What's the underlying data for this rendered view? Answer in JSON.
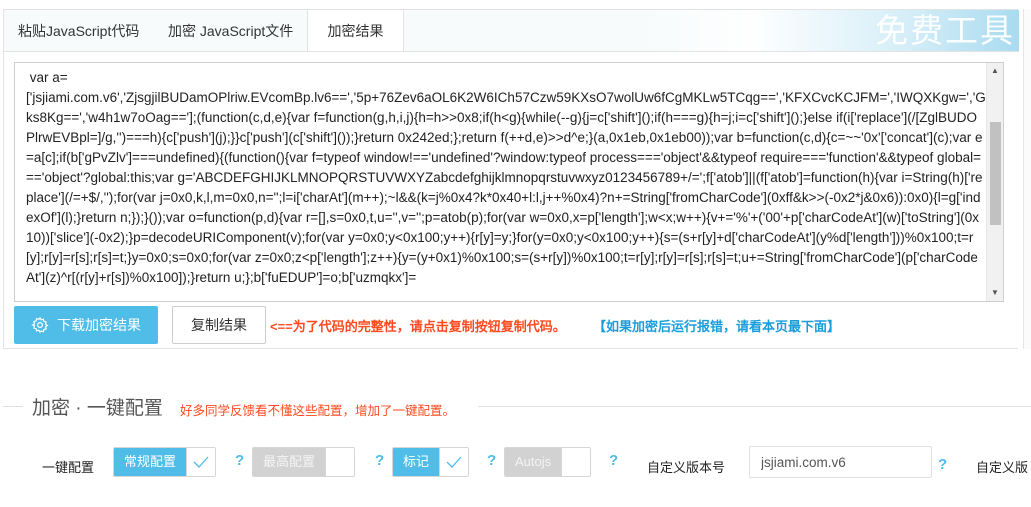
{
  "tabs": [
    {
      "label": "粘贴JavaScript代码",
      "active": false
    },
    {
      "label": "加密 JavaScript文件",
      "active": false
    },
    {
      "label": "加密结果",
      "active": true
    }
  ],
  "brand": "免费工具",
  "editor": {
    "code": " var a=\n['jsjiami.com.v6','ZjsgjilBUDamOPlriw.EVcomBp.lv6==','5p+76Zev6aOL6K2W6ICh57Czw59KXsO7wolUw6fCgMKLw5TCqg==','KFXCvcKCJFM=','IWQXKgw=','Gks8Kg==','w4h1w7oOag=='];(function(c,d,e){var f=function(g,h,i,j){h=h>>0x8;if(h<g){while(--g){j=c['shift']();if(h===g){h=j;i=c['shift']();}else if(i['replace'](/[ZglBUDOPlrwEVBpl=]/g,'')===h){c['push'](j);}}c['push'](c['shift']());}return 0x242ed;};return f(++d,e)>>d^e;}(a,0x1eb,0x1eb00));var b=function(c,d){c=~~'0x'['concat'](c);var e=a[c];if(b['gPvZlv']===undefined){(function(){var f=typeof window!=='undefined'?window:typeof process==='object'&&typeof require==='function'&&typeof global==='object'?global:this;var g='ABCDEFGHIJKLMNOPQRSTUVWXYZabcdefghijklmnopqrstuvwxyz0123456789+/=';f['atob']||(f['atob']=function(h){var i=String(h)['replace'](/=+$/,'');for(var j=0x0,k,l,m=0x0,n='';l=i['charAt'](m++);~l&&(k=j%0x4?k*0x40+l:l,j++%0x4)?n+=String['fromCharCode'](0xff&k>>(-0x2*j&0x6)):0x0){l=g['indexOf'](l);}return n;});}());var o=function(p,d){var r=[],s=0x0,t,u='',v='';p=atob(p);for(var w=0x0,x=p['length'];w<x;w++){v+='%'+('00'+p['charCodeAt'](w)['toString'](0x10))['slice'](-0x2);}p=decodeURIComponent(v);for(var y=0x0;y<0x100;y++){r[y]=y;}for(y=0x0;y<0x100;y++){s=(s+r[y]+d['charCodeAt'](y%d['length']))%0x100;t=r[y];r[y]=r[s];r[s]=t;}y=0x0;s=0x0;for(var z=0x0;z<p['length'];z++){y=(y+0x1)%0x100;s=(s+r[y])%0x100;t=r[y];r[y]=r[s];r[s]=t;u+=String['fromCharCode'](p['charCodeAt'](z)^r[(r[y]+r[s])%0x100]);}return u;};b['fuEDUP']=o;b['uzmqkx']=",
    "scroll_fraction": 0.3
  },
  "actions": {
    "download_label": "下载加密结果",
    "copy_label": "复制结果",
    "note_red": "<==为了代码的完整性，请点击复制按钮复制代码。",
    "note_blue": "【如果加密后运行报错，请看本页最下面】"
  },
  "section": {
    "title": "加密 · 一键配置",
    "subtitle": "好多同学反馈看不懂这些配置，增加了一键配置。"
  },
  "config": {
    "row_label": "一键配置",
    "toggles": [
      {
        "label": "常规配置",
        "checked": true
      },
      {
        "label": "最高配置",
        "checked": false
      },
      {
        "label": "标记",
        "checked": true
      },
      {
        "label": "Autojs",
        "checked": false
      }
    ],
    "help_symbol": "?",
    "version_label": "自定义版本号",
    "version_value": "jsjiami.com.v6",
    "next_label": "自定义版"
  },
  "colors": {
    "accent": "#4fbde7",
    "warning": "#ff4a1f",
    "info": "#1a9ddb",
    "disabled": "#d2d2d2"
  }
}
